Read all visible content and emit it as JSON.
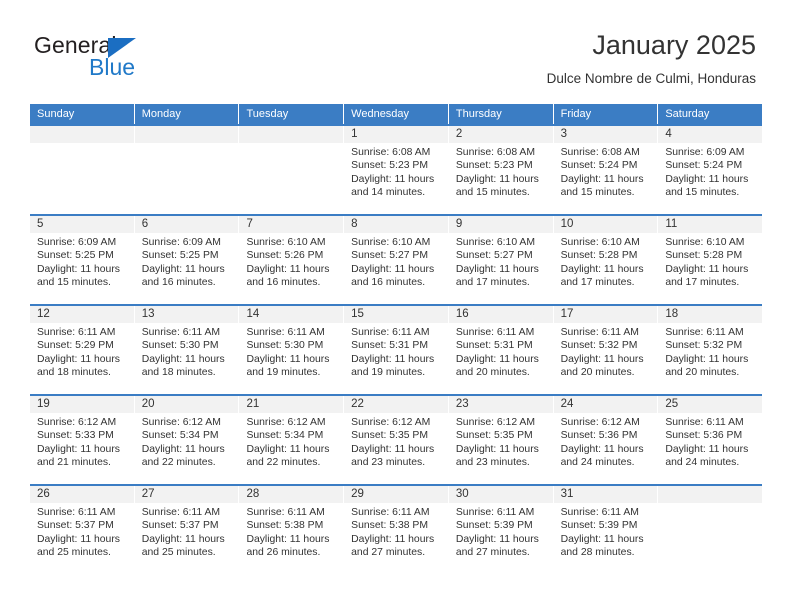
{
  "brand": {
    "name_top": "General",
    "name_bottom": "Blue",
    "accent_color": "#2079c8",
    "triangle_color": "#1b6ec2"
  },
  "header": {
    "title": "January 2025",
    "subtitle": "Dulce Nombre de Culmi, Honduras"
  },
  "theme": {
    "header_row_bg": "#3b7dc4",
    "day_number_bg": "#f2f2f2",
    "text_color": "#333333"
  },
  "weekdays": [
    "Sunday",
    "Monday",
    "Tuesday",
    "Wednesday",
    "Thursday",
    "Friday",
    "Saturday"
  ],
  "weeks": [
    [
      {
        "day": "",
        "sunrise": "",
        "sunset": "",
        "daylight_line1": "",
        "daylight_line2": ""
      },
      {
        "day": "",
        "sunrise": "",
        "sunset": "",
        "daylight_line1": "",
        "daylight_line2": ""
      },
      {
        "day": "",
        "sunrise": "",
        "sunset": "",
        "daylight_line1": "",
        "daylight_line2": ""
      },
      {
        "day": "1",
        "sunrise": "Sunrise: 6:08 AM",
        "sunset": "Sunset: 5:23 PM",
        "daylight_line1": "Daylight: 11 hours",
        "daylight_line2": "and 14 minutes."
      },
      {
        "day": "2",
        "sunrise": "Sunrise: 6:08 AM",
        "sunset": "Sunset: 5:23 PM",
        "daylight_line1": "Daylight: 11 hours",
        "daylight_line2": "and 15 minutes."
      },
      {
        "day": "3",
        "sunrise": "Sunrise: 6:08 AM",
        "sunset": "Sunset: 5:24 PM",
        "daylight_line1": "Daylight: 11 hours",
        "daylight_line2": "and 15 minutes."
      },
      {
        "day": "4",
        "sunrise": "Sunrise: 6:09 AM",
        "sunset": "Sunset: 5:24 PM",
        "daylight_line1": "Daylight: 11 hours",
        "daylight_line2": "and 15 minutes."
      }
    ],
    [
      {
        "day": "5",
        "sunrise": "Sunrise: 6:09 AM",
        "sunset": "Sunset: 5:25 PM",
        "daylight_line1": "Daylight: 11 hours",
        "daylight_line2": "and 15 minutes."
      },
      {
        "day": "6",
        "sunrise": "Sunrise: 6:09 AM",
        "sunset": "Sunset: 5:25 PM",
        "daylight_line1": "Daylight: 11 hours",
        "daylight_line2": "and 16 minutes."
      },
      {
        "day": "7",
        "sunrise": "Sunrise: 6:10 AM",
        "sunset": "Sunset: 5:26 PM",
        "daylight_line1": "Daylight: 11 hours",
        "daylight_line2": "and 16 minutes."
      },
      {
        "day": "8",
        "sunrise": "Sunrise: 6:10 AM",
        "sunset": "Sunset: 5:27 PM",
        "daylight_line1": "Daylight: 11 hours",
        "daylight_line2": "and 16 minutes."
      },
      {
        "day": "9",
        "sunrise": "Sunrise: 6:10 AM",
        "sunset": "Sunset: 5:27 PM",
        "daylight_line1": "Daylight: 11 hours",
        "daylight_line2": "and 17 minutes."
      },
      {
        "day": "10",
        "sunrise": "Sunrise: 6:10 AM",
        "sunset": "Sunset: 5:28 PM",
        "daylight_line1": "Daylight: 11 hours",
        "daylight_line2": "and 17 minutes."
      },
      {
        "day": "11",
        "sunrise": "Sunrise: 6:10 AM",
        "sunset": "Sunset: 5:28 PM",
        "daylight_line1": "Daylight: 11 hours",
        "daylight_line2": "and 17 minutes."
      }
    ],
    [
      {
        "day": "12",
        "sunrise": "Sunrise: 6:11 AM",
        "sunset": "Sunset: 5:29 PM",
        "daylight_line1": "Daylight: 11 hours",
        "daylight_line2": "and 18 minutes."
      },
      {
        "day": "13",
        "sunrise": "Sunrise: 6:11 AM",
        "sunset": "Sunset: 5:30 PM",
        "daylight_line1": "Daylight: 11 hours",
        "daylight_line2": "and 18 minutes."
      },
      {
        "day": "14",
        "sunrise": "Sunrise: 6:11 AM",
        "sunset": "Sunset: 5:30 PM",
        "daylight_line1": "Daylight: 11 hours",
        "daylight_line2": "and 19 minutes."
      },
      {
        "day": "15",
        "sunrise": "Sunrise: 6:11 AM",
        "sunset": "Sunset: 5:31 PM",
        "daylight_line1": "Daylight: 11 hours",
        "daylight_line2": "and 19 minutes."
      },
      {
        "day": "16",
        "sunrise": "Sunrise: 6:11 AM",
        "sunset": "Sunset: 5:31 PM",
        "daylight_line1": "Daylight: 11 hours",
        "daylight_line2": "and 20 minutes."
      },
      {
        "day": "17",
        "sunrise": "Sunrise: 6:11 AM",
        "sunset": "Sunset: 5:32 PM",
        "daylight_line1": "Daylight: 11 hours",
        "daylight_line2": "and 20 minutes."
      },
      {
        "day": "18",
        "sunrise": "Sunrise: 6:11 AM",
        "sunset": "Sunset: 5:32 PM",
        "daylight_line1": "Daylight: 11 hours",
        "daylight_line2": "and 20 minutes."
      }
    ],
    [
      {
        "day": "19",
        "sunrise": "Sunrise: 6:12 AM",
        "sunset": "Sunset: 5:33 PM",
        "daylight_line1": "Daylight: 11 hours",
        "daylight_line2": "and 21 minutes."
      },
      {
        "day": "20",
        "sunrise": "Sunrise: 6:12 AM",
        "sunset": "Sunset: 5:34 PM",
        "daylight_line1": "Daylight: 11 hours",
        "daylight_line2": "and 22 minutes."
      },
      {
        "day": "21",
        "sunrise": "Sunrise: 6:12 AM",
        "sunset": "Sunset: 5:34 PM",
        "daylight_line1": "Daylight: 11 hours",
        "daylight_line2": "and 22 minutes."
      },
      {
        "day": "22",
        "sunrise": "Sunrise: 6:12 AM",
        "sunset": "Sunset: 5:35 PM",
        "daylight_line1": "Daylight: 11 hours",
        "daylight_line2": "and 23 minutes."
      },
      {
        "day": "23",
        "sunrise": "Sunrise: 6:12 AM",
        "sunset": "Sunset: 5:35 PM",
        "daylight_line1": "Daylight: 11 hours",
        "daylight_line2": "and 23 minutes."
      },
      {
        "day": "24",
        "sunrise": "Sunrise: 6:12 AM",
        "sunset": "Sunset: 5:36 PM",
        "daylight_line1": "Daylight: 11 hours",
        "daylight_line2": "and 24 minutes."
      },
      {
        "day": "25",
        "sunrise": "Sunrise: 6:11 AM",
        "sunset": "Sunset: 5:36 PM",
        "daylight_line1": "Daylight: 11 hours",
        "daylight_line2": "and 24 minutes."
      }
    ],
    [
      {
        "day": "26",
        "sunrise": "Sunrise: 6:11 AM",
        "sunset": "Sunset: 5:37 PM",
        "daylight_line1": "Daylight: 11 hours",
        "daylight_line2": "and 25 minutes."
      },
      {
        "day": "27",
        "sunrise": "Sunrise: 6:11 AM",
        "sunset": "Sunset: 5:37 PM",
        "daylight_line1": "Daylight: 11 hours",
        "daylight_line2": "and 25 minutes."
      },
      {
        "day": "28",
        "sunrise": "Sunrise: 6:11 AM",
        "sunset": "Sunset: 5:38 PM",
        "daylight_line1": "Daylight: 11 hours",
        "daylight_line2": "and 26 minutes."
      },
      {
        "day": "29",
        "sunrise": "Sunrise: 6:11 AM",
        "sunset": "Sunset: 5:38 PM",
        "daylight_line1": "Daylight: 11 hours",
        "daylight_line2": "and 27 minutes."
      },
      {
        "day": "30",
        "sunrise": "Sunrise: 6:11 AM",
        "sunset": "Sunset: 5:39 PM",
        "daylight_line1": "Daylight: 11 hours",
        "daylight_line2": "and 27 minutes."
      },
      {
        "day": "31",
        "sunrise": "Sunrise: 6:11 AM",
        "sunset": "Sunset: 5:39 PM",
        "daylight_line1": "Daylight: 11 hours",
        "daylight_line2": "and 28 minutes."
      },
      {
        "day": "",
        "sunrise": "",
        "sunset": "",
        "daylight_line1": "",
        "daylight_line2": ""
      }
    ]
  ]
}
